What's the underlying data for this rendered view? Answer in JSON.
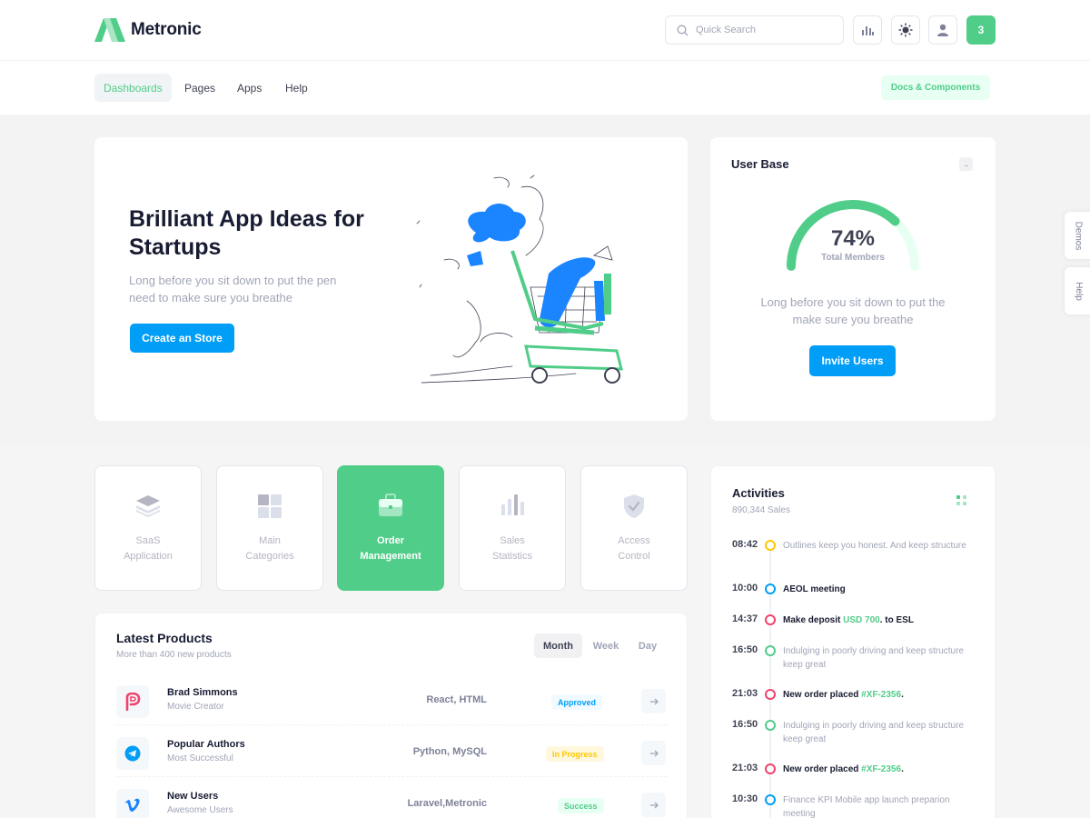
{
  "brand": {
    "name": "Metronic"
  },
  "header": {
    "search_placeholder": "Quick Search",
    "notification_count": "3"
  },
  "nav": {
    "items": [
      "Dashboards",
      "Pages",
      "Apps",
      "Help"
    ],
    "docs_label": "Docs & Components"
  },
  "hero": {
    "title": "Brilliant App Ideas for Startups",
    "text": "Long before you sit down to put the pen need to make sure you breathe",
    "button": "Create an Store"
  },
  "user_base": {
    "title": "User Base",
    "menu": "...",
    "percent": 74,
    "percent_label": "74%",
    "gauge_label": "Total Members",
    "text": "Long before you sit down to put the make sure you breathe",
    "button": "Invite Users"
  },
  "side_tabs": [
    "Demos",
    "Help"
  ],
  "tiles": [
    {
      "line1": "SaaS",
      "line2": "Application",
      "icon": "layers-icon"
    },
    {
      "line1": "Main",
      "line2": "Categories",
      "icon": "grid-icon"
    },
    {
      "line1": "Order",
      "line2": "Management",
      "icon": "briefcase-icon"
    },
    {
      "line1": "Sales",
      "line2": "Statistics",
      "icon": "chart-icon"
    },
    {
      "line1": "Access",
      "line2": "Control",
      "icon": "shield-icon"
    }
  ],
  "products": {
    "title": "Latest Products",
    "subtitle": "More than 400 new products",
    "tabs": [
      "Month",
      "Week",
      "Day"
    ],
    "rows": [
      {
        "name": "Brad Simmons",
        "sub": "Movie Creator",
        "tech": "React, HTML",
        "status": "Approved",
        "status_color": "#009ef7",
        "status_bg": "#f1faff",
        "logo": "p-icon"
      },
      {
        "name": "Popular Authors",
        "sub": "Most Successful",
        "tech": "Python, MySQL",
        "status": "In Progress",
        "status_color": "#ffc700",
        "status_bg": "#fff8dd",
        "logo": "telegram-icon"
      },
      {
        "name": "New Users",
        "sub": "Awesome Users",
        "tech": "Laravel,Metronic",
        "status": "Success",
        "status_color": "#50cd89",
        "status_bg": "#e8fff3",
        "logo": "vimeo-icon"
      }
    ]
  },
  "activities": {
    "title": "Activities",
    "subtitle": "890,344 Sales",
    "events": [
      {
        "time": "08:42",
        "color": "#ffc700",
        "style": "light",
        "text": "Outlines keep you honest. And keep structure"
      },
      {
        "time": "10:00",
        "color": "#009ef7",
        "style": "dark",
        "text": "AEOL meeting"
      },
      {
        "time": "14:37",
        "color": "#f1416c",
        "style": "dark",
        "text": "Make deposit ",
        "highlight": "USD 700",
        "after": ". to ESL"
      },
      {
        "time": "16:50",
        "color": "#50cd89",
        "style": "light",
        "text": "Indulging in poorly driving and keep structure keep great"
      },
      {
        "time": "21:03",
        "color": "#f1416c",
        "style": "dark",
        "text": "New order placed ",
        "highlight": "#XF-2356",
        "after": "."
      },
      {
        "time": "16:50",
        "color": "#50cd89",
        "style": "light",
        "text": "Indulging in poorly driving and keep structure keep great"
      },
      {
        "time": "21:03",
        "color": "#f1416c",
        "style": "dark",
        "text": "New order placed ",
        "highlight": "#XF-2356",
        "after": "."
      },
      {
        "time": "10:30",
        "color": "#009ef7",
        "style": "light",
        "text": "Finance KPI Mobile app launch preparion meeting"
      }
    ]
  },
  "colors": {
    "primary": "#009ef7",
    "success": "#50cd89",
    "warning": "#ffc700",
    "danger": "#f1416c"
  }
}
